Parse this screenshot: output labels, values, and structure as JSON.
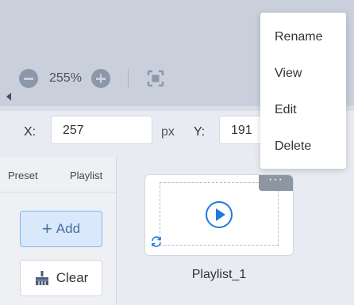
{
  "zoom": {
    "value": "255%"
  },
  "coords": {
    "x_label": "X:",
    "x_value": "257",
    "unit": "px",
    "y_label": "Y:",
    "y_value": "191"
  },
  "tabs": [
    {
      "label": "Preset"
    },
    {
      "label": "Playlist",
      "active": true
    }
  ],
  "buttons": {
    "add_label": "Add",
    "add_plus": "+",
    "clear_label": "Clear"
  },
  "playlist": {
    "items": [
      {
        "name": "Playlist_1",
        "more": "···"
      }
    ]
  },
  "context_menu": {
    "items": [
      "Rename",
      "View",
      "Edit",
      "Delete"
    ]
  },
  "colors": {
    "accent": "#1f7ae0",
    "canvas_bg": "#c9cfdb",
    "add_border": "#7fb7ef"
  }
}
